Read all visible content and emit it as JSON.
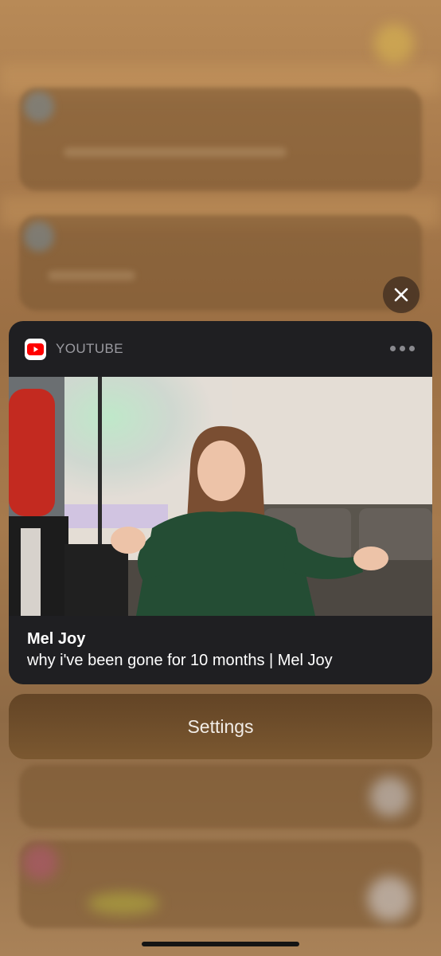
{
  "notification": {
    "app_name": "YOUTUBE",
    "app_icon": "youtube-logo-icon",
    "title": "Mel Joy",
    "body": "why i've been gone for 10 months | Mel Joy"
  },
  "actions": {
    "settings_label": "Settings",
    "close_icon": "close-icon",
    "more_icon": "ellipsis-icon"
  },
  "colors": {
    "card_background": "#1f1f22",
    "youtube_red": "#ff0000",
    "sweater_green": "#244d34"
  }
}
